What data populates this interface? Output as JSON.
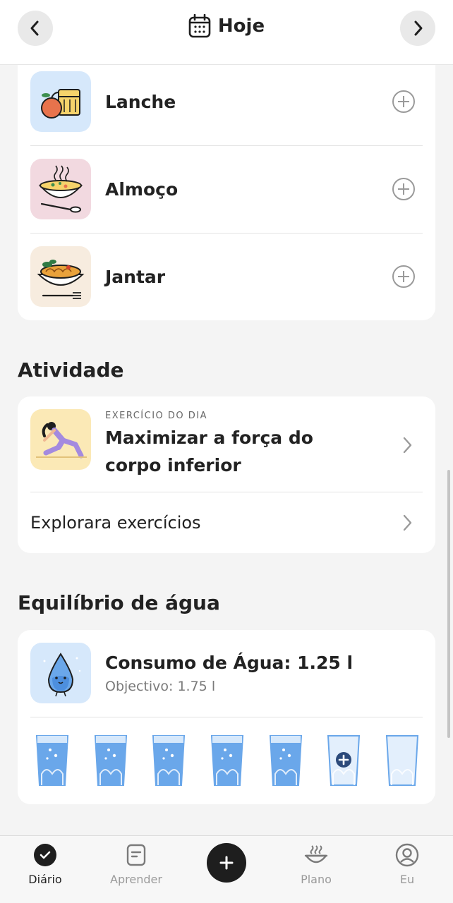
{
  "header": {
    "title": "Hoje",
    "prev_icon": "chevron-left-icon",
    "next_icon": "chevron-right-icon",
    "calendar_icon": "calendar-icon"
  },
  "meals": [
    {
      "name": "Lanche",
      "icon": "snack-illustration"
    },
    {
      "name": "Almoço",
      "icon": "soup-illustration"
    },
    {
      "name": "Jantar",
      "icon": "pasta-illustration"
    }
  ],
  "activity": {
    "section_title": "Atividade",
    "kicker": "EXERCÍCIO DO DIA",
    "exercise_title": "Maximizar a força do corpo inferior",
    "explore_label": "Explorara exercícios"
  },
  "water": {
    "section_title": "Equilíbrio de água",
    "consumption": "Consumo de Água: 1.25 l",
    "goal": "Objectivo: 1.75 l",
    "glasses_filled": 5,
    "glasses_total": 7
  },
  "tabbar": {
    "items": [
      {
        "label": "Diário",
        "icon": "check-circle-icon",
        "active": true
      },
      {
        "label": "Aprender",
        "icon": "document-icon",
        "active": false
      },
      {
        "label": "Plano",
        "icon": "bowl-icon",
        "active": false
      },
      {
        "label": "Eu",
        "icon": "user-circle-icon",
        "active": false
      }
    ],
    "add_icon": "plus-icon"
  },
  "colors": {
    "water_blue": "#6aa7ea",
    "dark": "#1e1e1e",
    "active_tab": "#222222",
    "inactive_tab": "#9a9a9a"
  }
}
